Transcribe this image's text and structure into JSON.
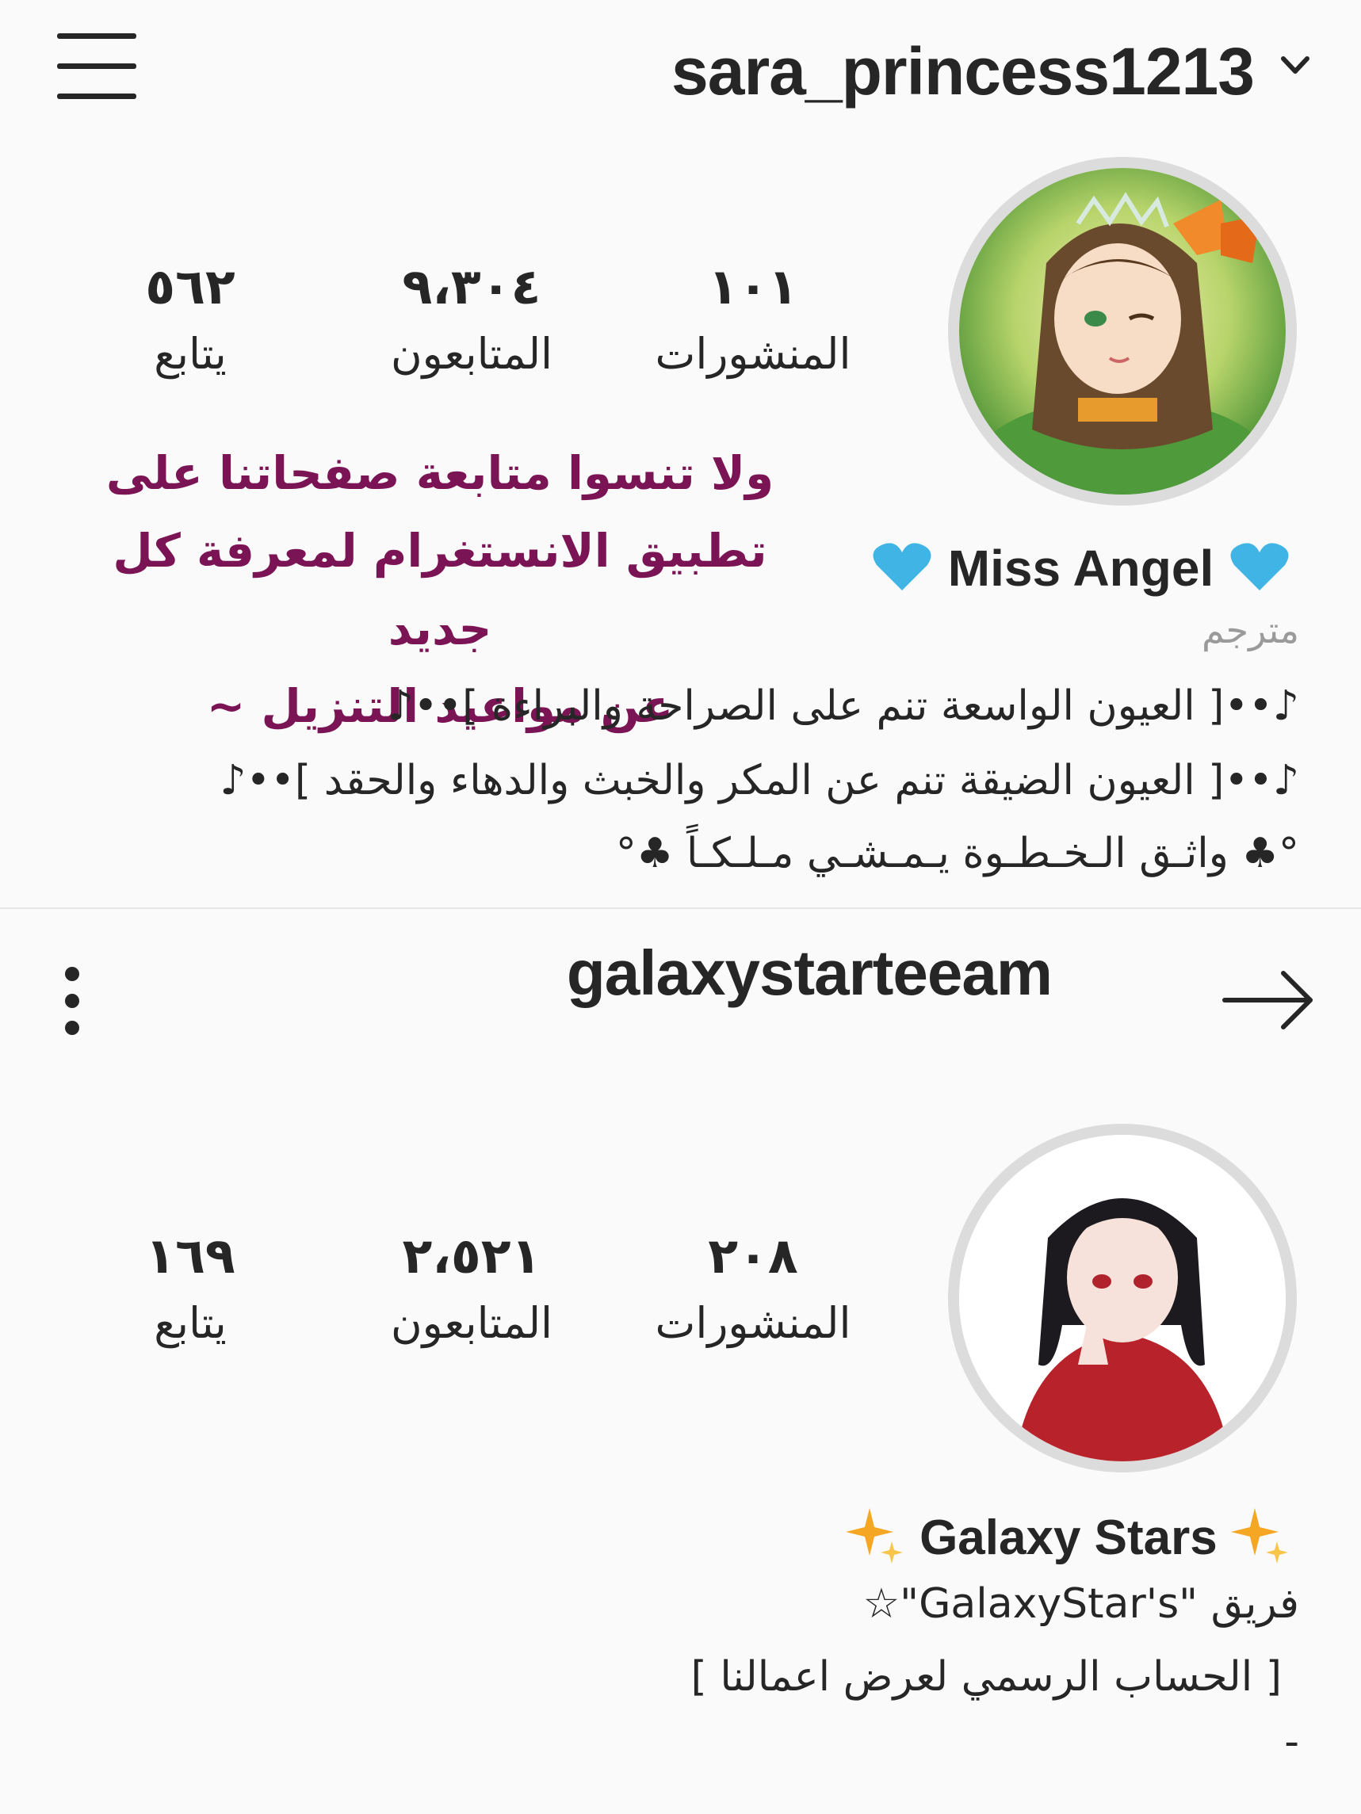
{
  "profile1": {
    "username": "sara_princess1213",
    "stats": {
      "posts": {
        "value": "١٠١",
        "label": "المنشورات"
      },
      "followers": {
        "value": "٩،٣٠٤",
        "label": "المتابعون"
      },
      "following": {
        "value": "٥٦٢",
        "label": "يتابع"
      }
    },
    "display_name": "Miss Angel",
    "heart_color": "#3fb4e5",
    "translate_label": "مترجم",
    "bio_lines": [
      "♪••[ العيون الواسعة تنم على الصراحة والبراءة ]••♪",
      "♪••[ العيون الضيقة تنم عن المكر والخبث والدهاء والحقد ]••♪",
      "°♣ واثـق الـخـطـوة يـمـشـي مـلـكـاً ♣°"
    ]
  },
  "overlay_text": [
    "ولا تنسوا متابعة صفحاتنا على",
    "تطبيق الانستغرام لمعرفة كل جديد",
    "عن مواعيد التنزيل ~"
  ],
  "overlay_color": "#7a1454",
  "profile2": {
    "username": "galaxystarteeam",
    "stats": {
      "posts": {
        "value": "٢٠٨",
        "label": "المنشورات"
      },
      "followers": {
        "value": "٢،٥٢١",
        "label": "المتابعون"
      },
      "following": {
        "value": "١٦٩",
        "label": "يتابع"
      }
    },
    "display_name": "Galaxy Stars",
    "sparkle_color": "#f5a623",
    "bio_lines": [
      "فريق \"GalaxyStar's\"☆",
      "[ الحساب الرسمي لعرض اعمالنا ]",
      "-"
    ]
  },
  "icons": {
    "menu": "hamburger-icon",
    "dropdown": "chevron-down-icon",
    "more": "more-vertical-icon",
    "go": "arrow-right-icon",
    "heart": "heart-icon",
    "sparkle": "sparkle-icon"
  }
}
